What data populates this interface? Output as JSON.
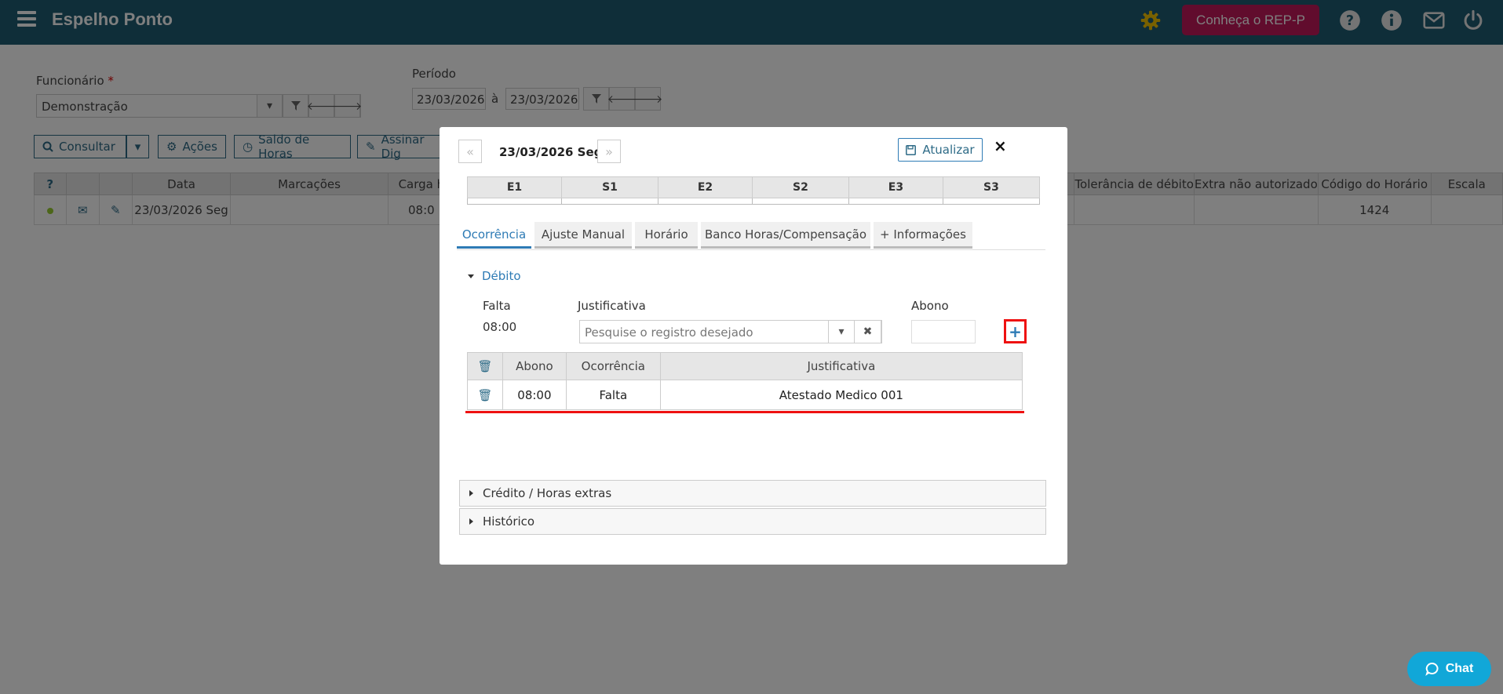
{
  "header": {
    "title": "Espelho Ponto",
    "rep_button": "Conheça o REP-P",
    "colors": {
      "bar": "#1f5d73",
      "rep": "#c2185b",
      "gear": "#f2c200"
    }
  },
  "filters": {
    "funcionario_label": "Funcionário",
    "required_mark": "*",
    "funcionario_value": "Demonstração",
    "periodo_label": "Período",
    "date_from": "23/03/2026",
    "date_sep": "à",
    "date_to": "23/03/2026"
  },
  "toolbar": {
    "consultar": "Consultar",
    "acoes": "Ações",
    "saldo": "Saldo de Horas",
    "assinar": "Assinar Dig"
  },
  "base_table": {
    "headers": [
      "?",
      "",
      "",
      "Data",
      "Marcações",
      "Carga h",
      "Tolerância de débito",
      "Extra não autorizado",
      "Código do Horário",
      "Escala"
    ],
    "row": {
      "data": "23/03/2026 Seg",
      "carga": "08:0",
      "codigo": "1424"
    }
  },
  "modal": {
    "day_title": "23/03/2026 Seg",
    "update_label": "Atualizar",
    "close": "×",
    "punch_headers": [
      "E1",
      "S1",
      "E2",
      "S2",
      "E3",
      "S3"
    ],
    "tabs": [
      "Ocorrência",
      "Ajuste Manual",
      "Horário",
      "Banco Horas/Compensação",
      "+ Informações"
    ],
    "active_tab": "Ocorrência",
    "section_debito": "Débito",
    "falta_label": "Falta",
    "falta_value": "08:00",
    "justificativa_label": "Justificativa",
    "search_placeholder": "Pesquise o registro desejado",
    "abono_label": "Abono",
    "abono_table": {
      "headers": [
        "Abono",
        "Ocorrência",
        "Justificativa"
      ],
      "rows": [
        {
          "abono": "08:00",
          "ocorrencia": "Falta",
          "justificativa": "Atestado Medico 001"
        }
      ]
    },
    "panel_credito": "Crédito / Horas extras",
    "panel_historico": "Histórico"
  },
  "chat": {
    "label": "Chat"
  },
  "icons": [
    "menu-icon",
    "gear-icon",
    "help-icon",
    "info-icon",
    "mail-icon",
    "power-icon",
    "search-icon",
    "filter-icon",
    "arrow-left-icon",
    "arrow-right-icon",
    "trash-icon",
    "save-icon",
    "plus-icon",
    "chat-icon"
  ]
}
